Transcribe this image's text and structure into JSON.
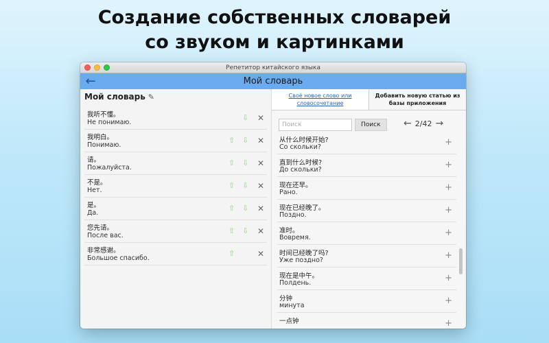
{
  "headline": {
    "line1": "Создание собственных словарей",
    "line2": "со звуком и картинками"
  },
  "window": {
    "title": "Репетитор китайского языка"
  },
  "navbar": {
    "title": "Мой словарь",
    "back_icon": "←"
  },
  "left": {
    "title": "Мой словарь",
    "edit_icon": "✎",
    "up_icon": "⇧",
    "down_icon": "⇩",
    "delete_icon": "✕",
    "items": [
      {
        "zh": "我听不懂。",
        "ru": "Не понимаю."
      },
      {
        "zh": "我明白。",
        "ru": "Понимаю."
      },
      {
        "zh": "请。",
        "ru": "Пожалуйста."
      },
      {
        "zh": "不是。",
        "ru": "Нет."
      },
      {
        "zh": "是。",
        "ru": "Да."
      },
      {
        "zh": "您先请。",
        "ru": "После вас."
      },
      {
        "zh": "非常感谢。",
        "ru": "Большое спасибо."
      }
    ]
  },
  "right": {
    "tab_own": "Своё новое слово или словосочетание",
    "tab_app": "Добавить новую статью из базы приложения",
    "search_placeholder": "Поиск",
    "search_button": "Поиск",
    "pager": {
      "prev_icon": "←",
      "label": "2/42",
      "next_icon": "→"
    },
    "plus_icon": "+",
    "phrases": [
      {
        "zh": "从什么时候开始?",
        "ru": "Со скольки?"
      },
      {
        "zh": "直到什么时候?",
        "ru": "До скольки?"
      },
      {
        "zh": "现在还早。",
        "ru": "Рано."
      },
      {
        "zh": "现在已经晚了。",
        "ru": "Поздно."
      },
      {
        "zh": "准时。",
        "ru": "Вовремя."
      },
      {
        "zh": "时间已经晚了吗?",
        "ru": "Уже поздно?"
      },
      {
        "zh": "现在是中午。",
        "ru": "Полдень."
      },
      {
        "zh": "分钟",
        "ru": "минута"
      },
      {
        "zh": "一点钟",
        "ru": ""
      }
    ]
  }
}
